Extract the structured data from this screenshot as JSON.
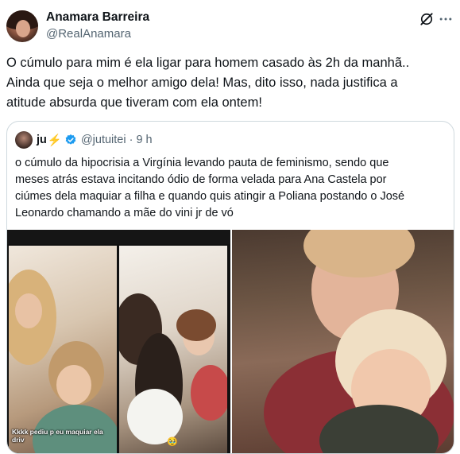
{
  "author": {
    "name": "Anamara Barreira",
    "handle": "@RealAnamara"
  },
  "tweet": {
    "text": "O cúmulo para mim é ela ligar para homem casado às 2h da manhã..\nAinda que seja o melhor amigo dela! Mas, dito isso, nada justifica a\natitude absurda que tiveram com ela ontem!"
  },
  "icons": {
    "grok": "grok-icon",
    "more": "more-options-icon",
    "verified": "verified-badge-icon"
  },
  "quote": {
    "name": "ju",
    "name_suffix": "⚡",
    "handle": "@jutuitei",
    "separator": "·",
    "time": "9 h",
    "text": "o cúmulo da hipocrisia a Virgínia levando pauta de feminismo, sendo que\nmeses atrás estava incitando ódio de forma velada para Ana Castela por\nciúmes dela maquiar a filha e quando quis atingir a Poliana postando o José\nLeonardo chamando a mãe do vini jr de vó",
    "media": {
      "left_caption": "Kkkk pediu p eu maquiar ela driv",
      "left_emoji": "🥹"
    }
  },
  "colors": {
    "text": "#0f1419",
    "secondary": "#536471",
    "border": "#cfd9de",
    "verified": "#1d9bf0"
  }
}
